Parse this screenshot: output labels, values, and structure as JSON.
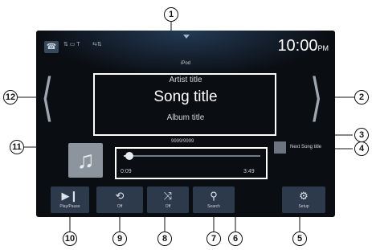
{
  "status_bar": {
    "phone_icon": "phone-icon",
    "left_status": "⇅ ▭ T",
    "right_status": "⇆⇅",
    "time": "10:00",
    "ampm": "PM"
  },
  "source": "iPod",
  "now_playing": {
    "artist": "Artist title",
    "song": "Song title",
    "album": "Album title",
    "track_counter": "9999/9999",
    "next_song": "Next Song title",
    "elapsed": "0:09",
    "total": "3:49",
    "progress_fraction": 0.04
  },
  "album_art_icon": "music-note-icon",
  "buttons": [
    {
      "id": "play-pause",
      "icon": "▶❙",
      "label": "Play/Pause"
    },
    {
      "id": "repeat",
      "icon": "⟲",
      "label": "Off"
    },
    {
      "id": "shuffle",
      "icon": "⤨",
      "label": "Off"
    },
    {
      "id": "search",
      "icon": "⚲",
      "label": "Search"
    },
    {
      "id": "setup",
      "icon": "⚙",
      "label": "Setup"
    }
  ],
  "callouts": [
    "1",
    "2",
    "3",
    "4",
    "5",
    "6",
    "7",
    "8",
    "9",
    "10",
    "11",
    "12"
  ],
  "colors": {
    "screen_bg": "#0a0d12",
    "button_bg": "#2d3a4b",
    "highlight_box": "#ffffff"
  }
}
